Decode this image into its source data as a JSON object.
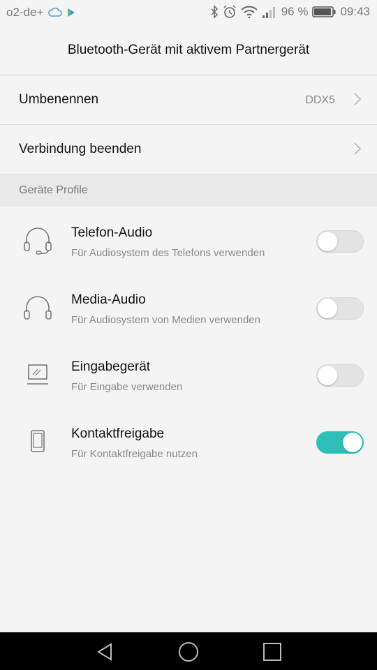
{
  "status_bar": {
    "carrier": "o2-de+",
    "battery_percent": "96 %",
    "time": "09:43",
    "icons": [
      "cloud-icon",
      "play-store-icon",
      "bluetooth-icon",
      "alarm-icon",
      "wifi-icon",
      "signal-icon",
      "battery-icon"
    ],
    "battery_level": 0.96
  },
  "header": {
    "title": "Bluetooth-Gerät mit aktivem Partnergerät"
  },
  "settings": {
    "rename_label": "Umbenennen",
    "rename_value": "DDX5",
    "disconnect_label": "Verbindung beenden"
  },
  "section": {
    "title": "Geräte Profile"
  },
  "profiles": [
    {
      "title": "Telefon-Audio",
      "subtitle": "Für Audiosystem des Telefons verwenden",
      "icon": "headset-icon",
      "enabled": false
    },
    {
      "title": "Media-Audio",
      "subtitle": "Für Audiosystem von Medien verwenden",
      "icon": "headphones-icon",
      "enabled": false
    },
    {
      "title": "Eingabegerät",
      "subtitle": "Für Eingabe verwenden",
      "icon": "input-device-icon",
      "enabled": false
    },
    {
      "title": "Kontaktfreigabe",
      "subtitle": "Für Kontaktfreigabe nutzen",
      "icon": "phone-icon",
      "enabled": true
    }
  ],
  "colors": {
    "accent": "#2ebfb8",
    "toggle_off": "#e3e3e3",
    "background": "#f4f4f4",
    "section_bg": "#e9e9e9"
  },
  "nav_bar": {
    "icons": [
      "back-icon",
      "home-icon",
      "recents-icon"
    ]
  }
}
